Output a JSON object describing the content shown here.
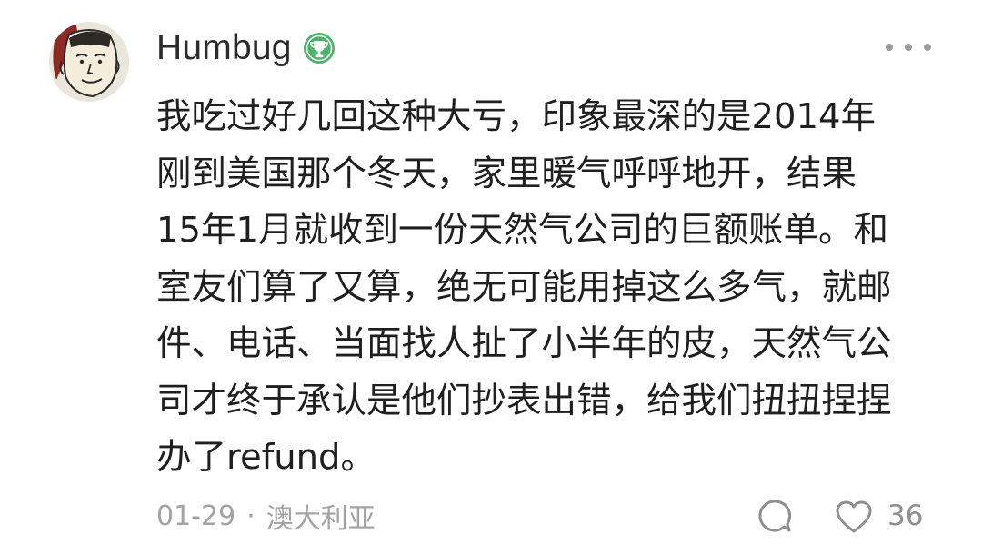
{
  "comment": {
    "author": {
      "name": "Humbug",
      "avatar": "avatar-cartoon-face",
      "badge_icon": "trophy-badge-icon",
      "badge_color": "#4cb46a"
    },
    "more_icon": "more-horizontal-icon",
    "body": "我吃过好几回这种大亏，印象最深的是2014年\n刚到美国那个冬天，家里暖气呼呼地开，结果\n15年1月就收到一份天然气公司的巨额账单。和\n室友们算了又算，绝无可能用掉这么多气，就邮\n件、电话、当面找人扯了小半年的皮，天然气公\n司才终于承认是他们抄表出错，给我们扭扭捏捏\n办了refund。",
    "date": "01-29",
    "separator": "·",
    "location": "澳大利亚",
    "reply_icon": "comment-bubble-icon",
    "like_icon": "heart-outline-icon",
    "like_count": "36"
  },
  "colors": {
    "text_primary": "#1f1f1f",
    "text_secondary": "#a3a3a3",
    "icon_gray": "#8f8f8f"
  }
}
